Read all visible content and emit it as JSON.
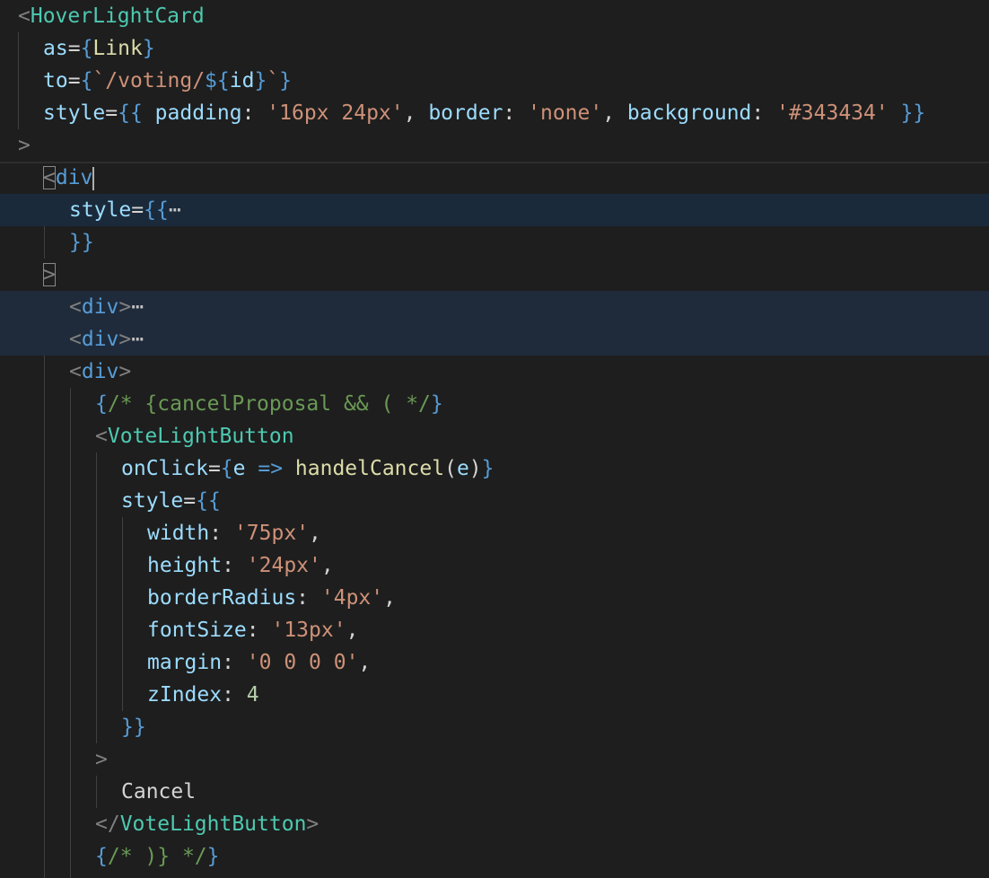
{
  "lines": [
    {
      "parts": [
        "<",
        "HoverLightCard"
      ]
    },
    {
      "parts": [
        "as",
        "=",
        "{",
        "Link",
        "}"
      ]
    },
    {
      "parts": [
        "to",
        "=",
        "{",
        "`/voting/",
        "${",
        "id",
        "}",
        "`",
        "}"
      ]
    },
    {
      "parts": [
        "style",
        "=",
        "{{",
        " padding",
        ": ",
        "'16px 24px'",
        ", ",
        "border",
        ": ",
        "'none'",
        ", ",
        "background",
        ": ",
        "'#343434'",
        " }}"
      ]
    },
    {
      "parts": [
        ">"
      ]
    },
    {
      "parts": [
        "<",
        "div"
      ]
    },
    {
      "parts": [
        "style",
        "=",
        "{{",
        "⋯"
      ]
    },
    {
      "parts": [
        "}}"
      ]
    },
    {
      "parts": [
        ">"
      ]
    },
    {
      "parts": [
        "<",
        "div",
        ">",
        "⋯"
      ]
    },
    {
      "parts": [
        "<",
        "div",
        ">",
        "⋯"
      ]
    },
    {
      "parts": [
        "<",
        "div",
        ">"
      ]
    },
    {
      "parts": [
        "{",
        "/* {cancelProposal && ( */",
        "}"
      ]
    },
    {
      "parts": [
        "<",
        "VoteLightButton"
      ]
    },
    {
      "parts": [
        "onClick",
        "=",
        "{",
        "e",
        " => ",
        "handelCancel",
        "(",
        "e",
        ")",
        "}"
      ]
    },
    {
      "parts": [
        "style",
        "=",
        "{{"
      ]
    },
    {
      "parts": [
        "width",
        ": ",
        "'75px'",
        ","
      ]
    },
    {
      "parts": [
        "height",
        ": ",
        "'24px'",
        ","
      ]
    },
    {
      "parts": [
        "borderRadius",
        ": ",
        "'4px'",
        ","
      ]
    },
    {
      "parts": [
        "fontSize",
        ": ",
        "'13px'",
        ","
      ]
    },
    {
      "parts": [
        "margin",
        ": ",
        "'0 0 0 0'",
        ","
      ]
    },
    {
      "parts": [
        "zIndex",
        ": ",
        "4"
      ]
    },
    {
      "parts": [
        "}}"
      ]
    },
    {
      "parts": [
        ">"
      ]
    },
    {
      "parts": [
        "Cancel"
      ]
    },
    {
      "parts": [
        "</",
        "VoteLightButton",
        ">"
      ]
    },
    {
      "parts": [
        "{",
        "/* )} */",
        "}"
      ]
    }
  ],
  "colors": {
    "background": "#1e1e1e",
    "component_tag": "#4ec9b0",
    "html_tag": "#569cd6",
    "attribute": "#9cdcfe",
    "string": "#ce9178",
    "number": "#b5cea8",
    "comment": "#6a9955",
    "function": "#dcdcaa",
    "highlight": "#1b2a3a"
  }
}
